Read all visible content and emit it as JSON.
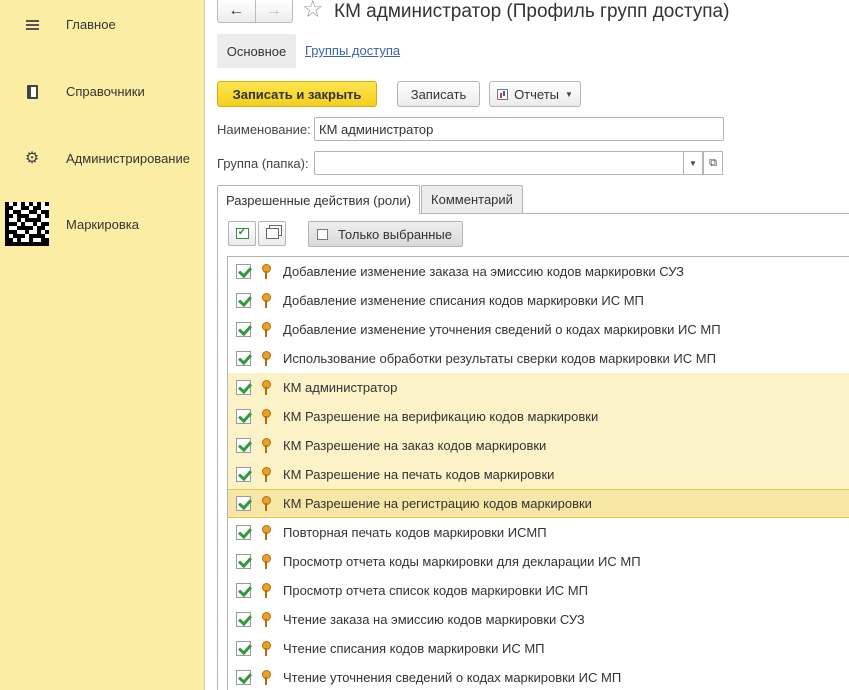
{
  "sidebar": {
    "items": [
      {
        "label": "Главное",
        "icon": "menu-icon"
      },
      {
        "label": "Справочники",
        "icon": "book-icon"
      },
      {
        "label": "Администрирование",
        "icon": "gear-icon"
      },
      {
        "label": "Маркировка",
        "icon": "datamatrix-icon"
      }
    ]
  },
  "header": {
    "back": "←",
    "forward": "→",
    "star": "☆",
    "title": "КМ администратор (Профиль групп доступа)"
  },
  "form_tabs": {
    "main": "Основное",
    "link": "Группы доступа"
  },
  "toolbar": {
    "save_close": "Записать и закрыть",
    "save": "Записать",
    "reports": "Отчеты",
    "reports_caret": "▼"
  },
  "fields": {
    "name_label": "Наименование:",
    "name_value": "КМ администратор",
    "group_label": "Группа (папка):",
    "group_value": "",
    "dropdown_caret": "▼",
    "open_icon": "⧉"
  },
  "panel_tabs": {
    "roles": "Разрешенные действия (роли)",
    "comment": "Комментарий"
  },
  "list_toolbar": {
    "only_selected": "Только выбранные"
  },
  "roles": [
    {
      "label": "Добавление изменение заказа на эмиссию кодов маркировки СУЗ",
      "checked": true,
      "state": "normal"
    },
    {
      "label": "Добавление изменение списания кодов маркировки ИС МП",
      "checked": true,
      "state": "normal"
    },
    {
      "label": "Добавление изменение уточнения сведений о кодах маркировки ИС МП",
      "checked": true,
      "state": "normal"
    },
    {
      "label": "Использование обработки результаты сверки кодов маркировки ИС МП",
      "checked": true,
      "state": "normal"
    },
    {
      "label": "КМ администратор",
      "checked": true,
      "state": "highlighted"
    },
    {
      "label": "КМ Разрешение на верификацию кодов маркировки",
      "checked": true,
      "state": "highlighted"
    },
    {
      "label": "КМ Разрешение на заказ кодов маркировки",
      "checked": true,
      "state": "highlighted"
    },
    {
      "label": "КМ Разрешение на печать кодов маркировки",
      "checked": true,
      "state": "highlighted"
    },
    {
      "label": "КМ Разрешение на регистрацию кодов маркировки",
      "checked": true,
      "state": "selected"
    },
    {
      "label": "Повторная печать кодов маркировки ИСМП",
      "checked": true,
      "state": "normal"
    },
    {
      "label": "Просмотр отчета коды маркировки для декларации ИС МП",
      "checked": true,
      "state": "normal"
    },
    {
      "label": "Просмотр отчета список кодов маркировки ИС МП",
      "checked": true,
      "state": "normal"
    },
    {
      "label": "Чтение заказа на эмиссию кодов маркировки СУЗ",
      "checked": true,
      "state": "normal"
    },
    {
      "label": "Чтение списания кодов маркировки ИС МП",
      "checked": true,
      "state": "normal"
    },
    {
      "label": "Чтение уточнения сведений о кодах маркировки ИС МП",
      "checked": true,
      "state": "normal"
    }
  ],
  "colors": {
    "sidebar_bg": "#fbeea4",
    "primary_button": "#f4cf1f",
    "row_highlight": "#fbf2c8",
    "row_selected": "#f6e7a6",
    "link": "#3a64b2",
    "check": "#2f9a3a",
    "key": "#e8a128"
  }
}
